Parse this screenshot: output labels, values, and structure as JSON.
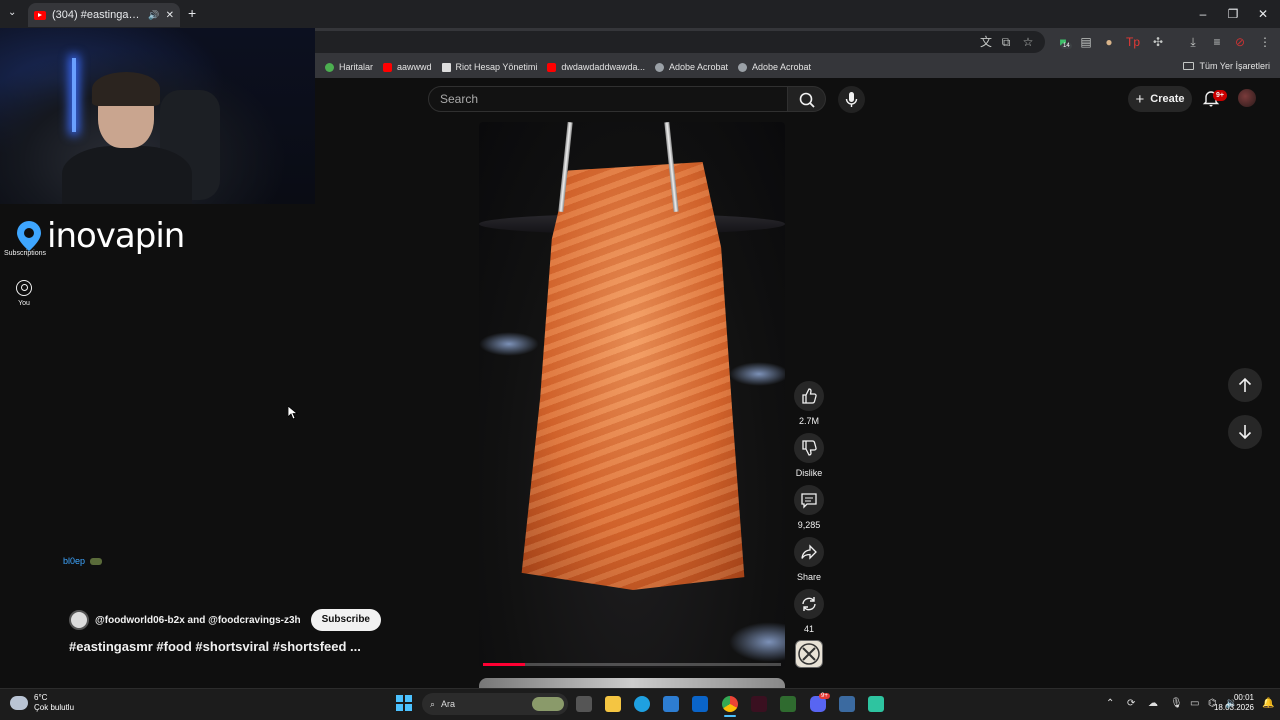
{
  "browser": {
    "tab_title": "(304) #eastingasmr #food #",
    "bookmarks": [
      "Haritalar",
      "aawwwd",
      "Riot Hesap Yönetimi",
      "dwdawdaddwawda...",
      "Adobe Acrobat",
      "Adobe Acrobat"
    ],
    "all_bookmarks": "Tüm Yer İşaretleri",
    "extension_badge": "14"
  },
  "youtube": {
    "search_placeholder": "Search",
    "create_label": "Create",
    "notification_count": "9+",
    "sidebar": {
      "logo_text": "inovapin",
      "subscriptions_label": "Subscriptions",
      "you_label": "You"
    },
    "chat_username": "bl0ep",
    "short": {
      "channel": "@foodworld06-b2x and @foodcravings-z3h",
      "subscribe_label": "Subscribe",
      "title": "#eastingasmr #food #shortsviral #shortsfeed ...",
      "progress": 0.14
    },
    "actions": {
      "likes": "2.7M",
      "dislike_label": "Dislike",
      "comments": "9,285",
      "share_label": "Share",
      "remix_count": "41"
    }
  },
  "taskbar": {
    "temperature": "6°C",
    "weather": "Çok bulutlu",
    "search_label": "Ara",
    "time": "00:01",
    "date": "18.03.2026",
    "discord_badge": "9+"
  }
}
